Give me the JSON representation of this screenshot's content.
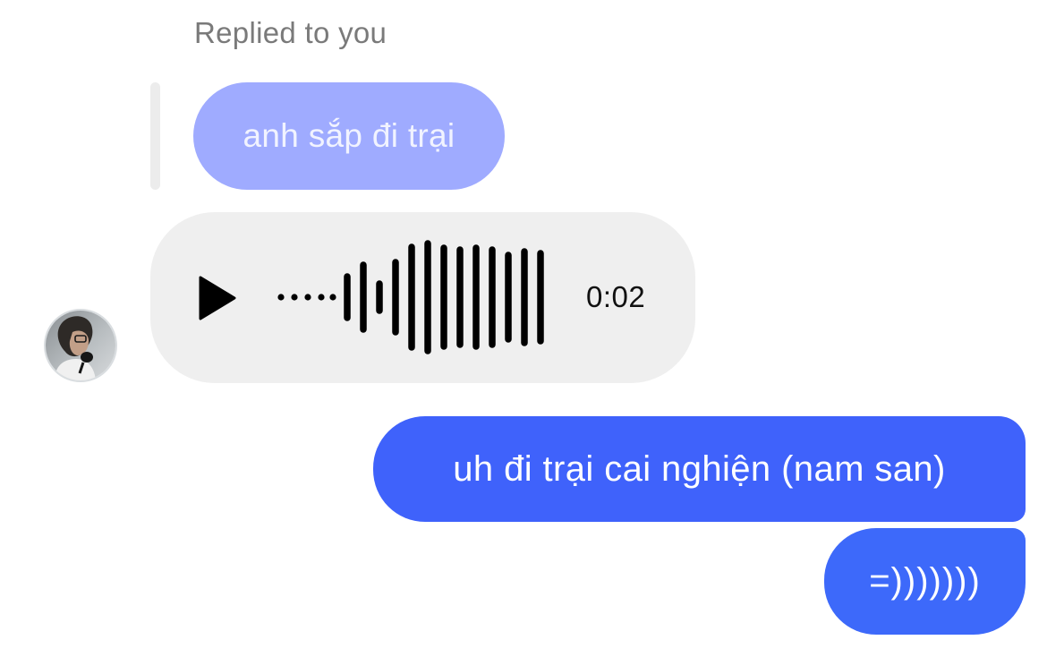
{
  "reply_context": {
    "label": "Replied to you",
    "quoted_message": "anh sắp đi trại"
  },
  "voice_message": {
    "duration": "0:02",
    "play_icon": "play-icon"
  },
  "messages": [
    {
      "text": "uh đi trại cai nghiện (nam san)"
    },
    {
      "text": "=)))))))"
    }
  ],
  "colors": {
    "sent_bubble": "#3f62fb",
    "quoted_bubble": "#9fabff",
    "received_bubble": "#efefef",
    "label_text": "#7a7a7a"
  }
}
